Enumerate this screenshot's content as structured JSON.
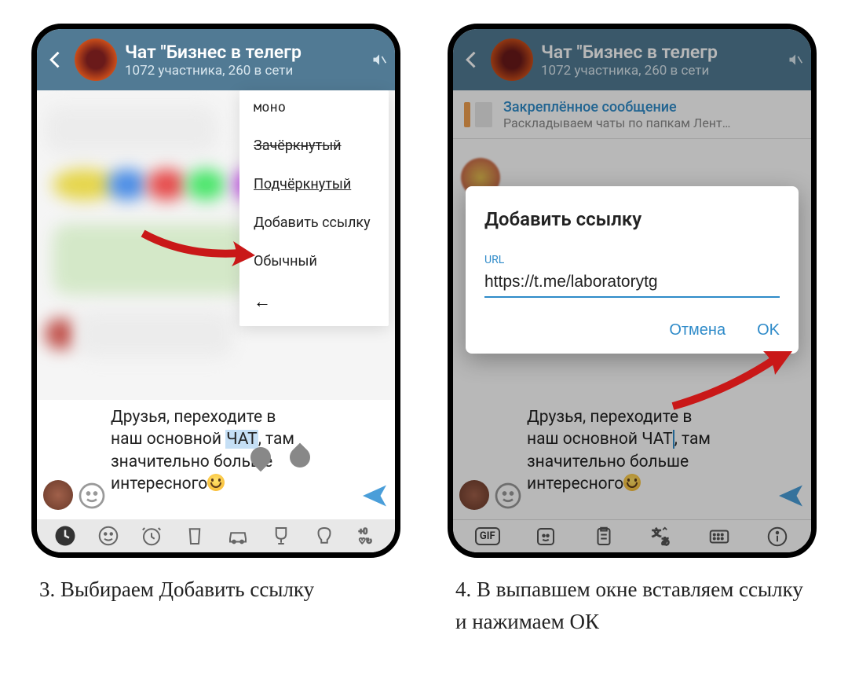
{
  "header": {
    "title": "Чат \"Бизнес в телегр",
    "subtitle": "1072 участника, 260 в сети"
  },
  "pinned": {
    "title": "Закреплённое сообщение",
    "subtitle": "Раскладываем чаты по папкам  Лент…"
  },
  "menu": {
    "mono": "моно",
    "strike": "Зачёркнутый",
    "underline": "Подчёркнутый",
    "addlink": "Добавить ссылку",
    "plain": "Обычный",
    "back": "←"
  },
  "message": {
    "line1": "Друзья, переходите в",
    "line2a": "наш основной ",
    "line2b_sel": "ЧАТ",
    "line2c": ", там",
    "line3": "значительно больше",
    "line4": "интересного"
  },
  "dialog": {
    "title": "Добавить ссылку",
    "label": "URL",
    "value": "https://t.me/laboratorytg",
    "cancel": "Отмена",
    "ok": "OK"
  },
  "captions": {
    "step3": "3. Выбираем Добавить ссылку",
    "step4": "4. В выпавшем окне вставляем ссылку и нажимаем ОК"
  },
  "icons": {
    "gif": "GIF"
  }
}
